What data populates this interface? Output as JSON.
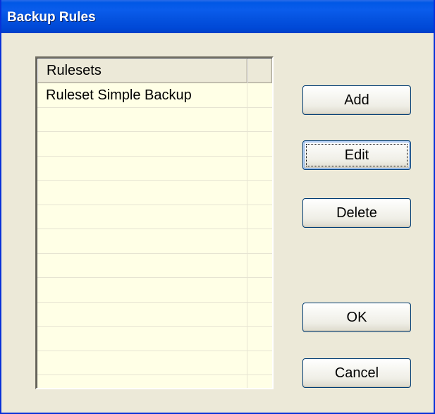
{
  "window": {
    "title": "Backup Rules"
  },
  "list": {
    "column_header": "Rulesets",
    "extra_header": "",
    "rows": [
      "Ruleset Simple Backup",
      "",
      "",
      "",
      "",
      "",
      "",
      "",
      "",
      "",
      "",
      "",
      ""
    ]
  },
  "buttons": {
    "add": "Add",
    "edit": "Edit",
    "delete": "Delete",
    "ok": "OK",
    "cancel": "Cancel"
  },
  "colors": {
    "title_bar": "#0054E3",
    "list_background": "#FFFFE6",
    "dialog_background": "#ECE9D8"
  }
}
